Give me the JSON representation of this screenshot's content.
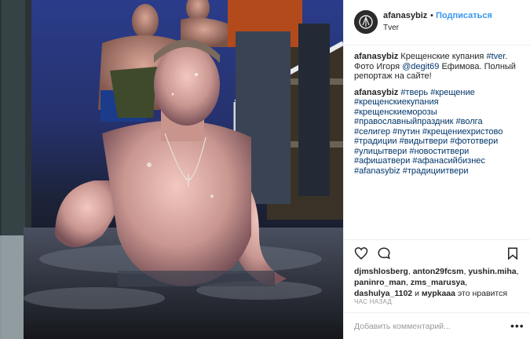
{
  "post": {
    "username": "afanasybiz",
    "dot": "•",
    "follow_label": "Подписаться",
    "location": "Tver",
    "avatar_letter": "A"
  },
  "caption": {
    "author": "afanasybiz",
    "text_1": " Крещенские купания ",
    "tag_1": "#tver",
    "text_2": ". Фото Игоря ",
    "mention": "@degit69",
    "text_3": " Ефимова. Полный репортаж на сайте!"
  },
  "hashtag_comment": {
    "author": "afanasybiz",
    "tags": [
      "#тверь",
      "#крещение",
      "#крещенскиекупания",
      "#крещенскиеморозы",
      "#православныйпраздник",
      "#волга",
      "#селигер",
      "#путин",
      "#крещениехристово",
      "#традиции",
      "#видытвери",
      "#фототвери",
      "#улицытвери",
      "#новоститвери",
      "#афишатвери",
      "#афанасийбизнес",
      "#afanasybiz",
      "#традициитвери"
    ]
  },
  "likes": {
    "users": [
      "djmshlosberg",
      "anton29fcsm",
      "yushin.miha",
      "paninro_man",
      "zms_marusya",
      "dashulya_1102",
      "мурkaaa"
    ],
    "and_label": "и",
    "suffix": "это нравится"
  },
  "time_ago": "ЧАС НАЗАД",
  "comment_box": {
    "placeholder": "Добавить комментарий...",
    "more_label": "•••"
  },
  "icons": {
    "like": "heart-icon",
    "comment": "comment-bubble-icon",
    "save": "bookmark-icon"
  },
  "colors": {
    "link": "#3897f0",
    "hashtag": "#003569",
    "muted": "#999999",
    "text": "#262626"
  }
}
